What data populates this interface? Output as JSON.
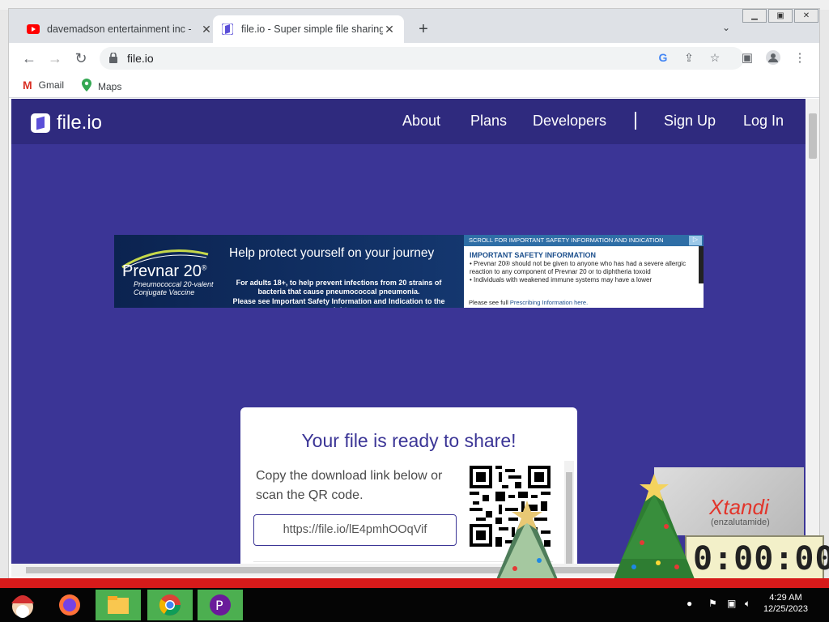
{
  "browser": {
    "tabs": [
      {
        "title": "davemadson entertainment inc -",
        "favicon": "youtube-icon",
        "active": false
      },
      {
        "title": "file.io - Super simple file sharing",
        "favicon": "fileio-icon",
        "active": true
      }
    ],
    "url": "file.io",
    "bookmarks": [
      {
        "label": "Gmail",
        "icon": "gmail-icon"
      },
      {
        "label": "Maps",
        "icon": "maps-icon"
      }
    ]
  },
  "site": {
    "brand": "file.io",
    "nav": {
      "about": "About",
      "plans": "Plans",
      "developers": "Developers",
      "signup": "Sign Up",
      "login": "Log In"
    }
  },
  "ad": {
    "brand": "Prevnar 20",
    "brand_sup": "®",
    "brand_sub_1": "Pneumococcal 20-valent",
    "brand_sub_2": "Conjugate Vaccine",
    "headline": "Help protect yourself on your journey",
    "body": "For adults 18+, to help prevent infections from 20 strains of bacteria that cause pneumococcal pneumonia.",
    "body_footer": "Please see Important Safety Information and Indication to the right",
    "scroll_bar": "SCROLL FOR IMPORTANT SAFETY INFORMATION AND INDICATION",
    "isi_title": "IMPORTANT SAFETY INFORMATION",
    "isi_1": "• Prevnar 20® should not be given to anyone who has had a severe allergic reaction to any component of Prevnar 20 or to diphtheria toxoid",
    "isi_2": "• Individuals with weakened immune systems may have a lower",
    "isi_footer": "Please see full",
    "isi_link": "Prescribing Information here."
  },
  "card": {
    "title": "Your file is ready to share!",
    "instructions": "Copy the download link below or scan the QR code.",
    "link": "https://file.io/lE4pmhOOqVif"
  },
  "widget": {
    "brand": "Xtandi",
    "sub": "(enzalutamide)",
    "timer": "0:00:00"
  },
  "taskbar": {
    "time": "4:29 AM",
    "date": "12/25/2023"
  }
}
